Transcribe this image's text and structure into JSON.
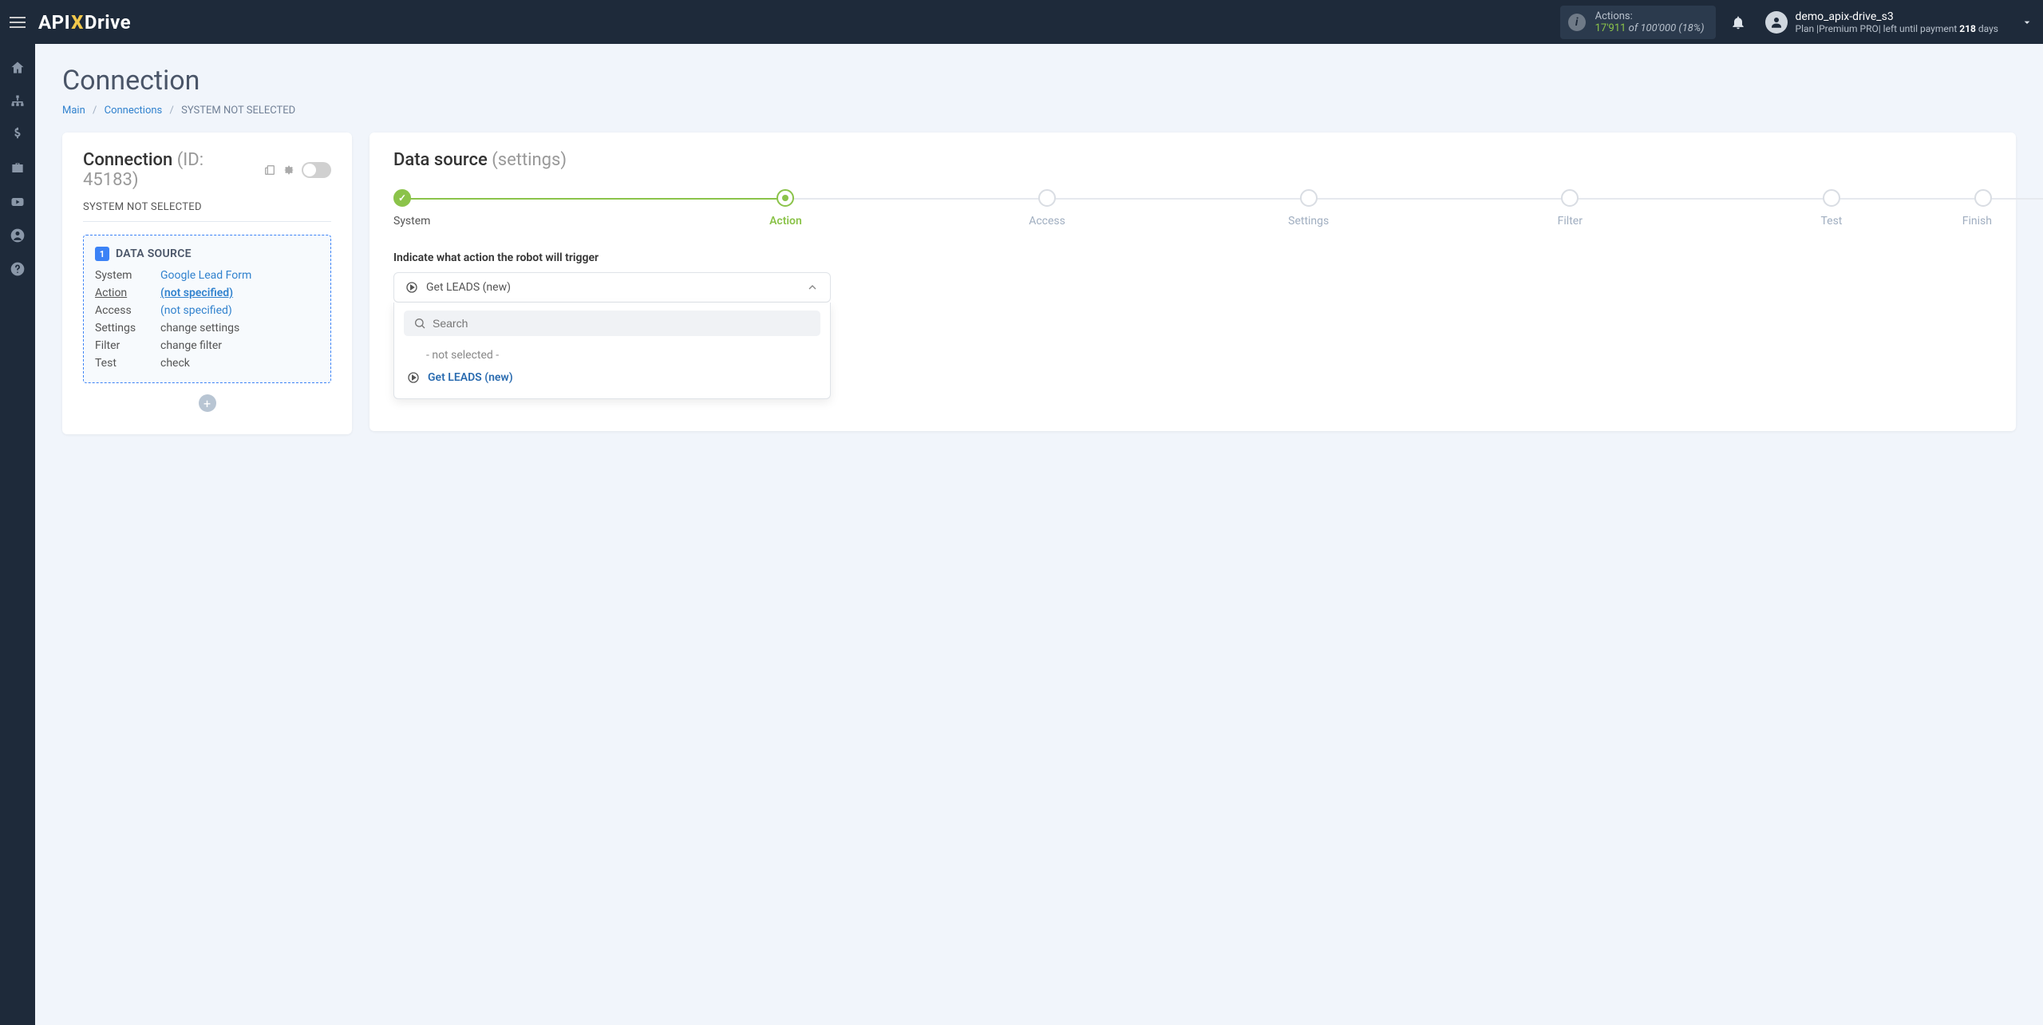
{
  "header": {
    "logo": {
      "api": "API",
      "x": "X",
      "drive": "Drive"
    },
    "actions": {
      "label": "Actions:",
      "used": "17'911",
      "of": "of",
      "total": "100'000",
      "pct": "(18%)"
    },
    "user": {
      "name": "demo_apix-drive_s3",
      "plan_prefix": "Plan |",
      "plan_name": "Premium PRO",
      "plan_mid": "| left until payment ",
      "plan_days": "218",
      "plan_suffix": " days"
    }
  },
  "page": {
    "title": "Connection",
    "breadcrumb": {
      "main": "Main",
      "connections": "Connections",
      "current": "SYSTEM NOT SELECTED"
    }
  },
  "left_card": {
    "title": "Connection",
    "id_label": "(ID: 45183)",
    "status": "SYSTEM NOT SELECTED",
    "ds_section": {
      "badge": "1",
      "title": "DATA SOURCE",
      "rows": {
        "system": {
          "label": "System",
          "value": "Google Lead Form"
        },
        "action": {
          "label": "Action",
          "value": "(not specified)"
        },
        "access": {
          "label": "Access",
          "value": "(not specified)"
        },
        "settings": {
          "label": "Settings",
          "value": "change settings"
        },
        "filter": {
          "label": "Filter",
          "value": "change filter"
        },
        "test": {
          "label": "Test",
          "value": "check"
        }
      }
    }
  },
  "right_card": {
    "title": "Data source",
    "subtitle": "(settings)",
    "steps": [
      "System",
      "Action",
      "Access",
      "Settings",
      "Filter",
      "Test",
      "Finish"
    ],
    "instruction": "Indicate what action the robot will trigger",
    "dropdown": {
      "selected": "Get LEADS (new)",
      "search_placeholder": "Search",
      "not_selected": "- not selected -",
      "option1": "Get LEADS (new)"
    }
  }
}
